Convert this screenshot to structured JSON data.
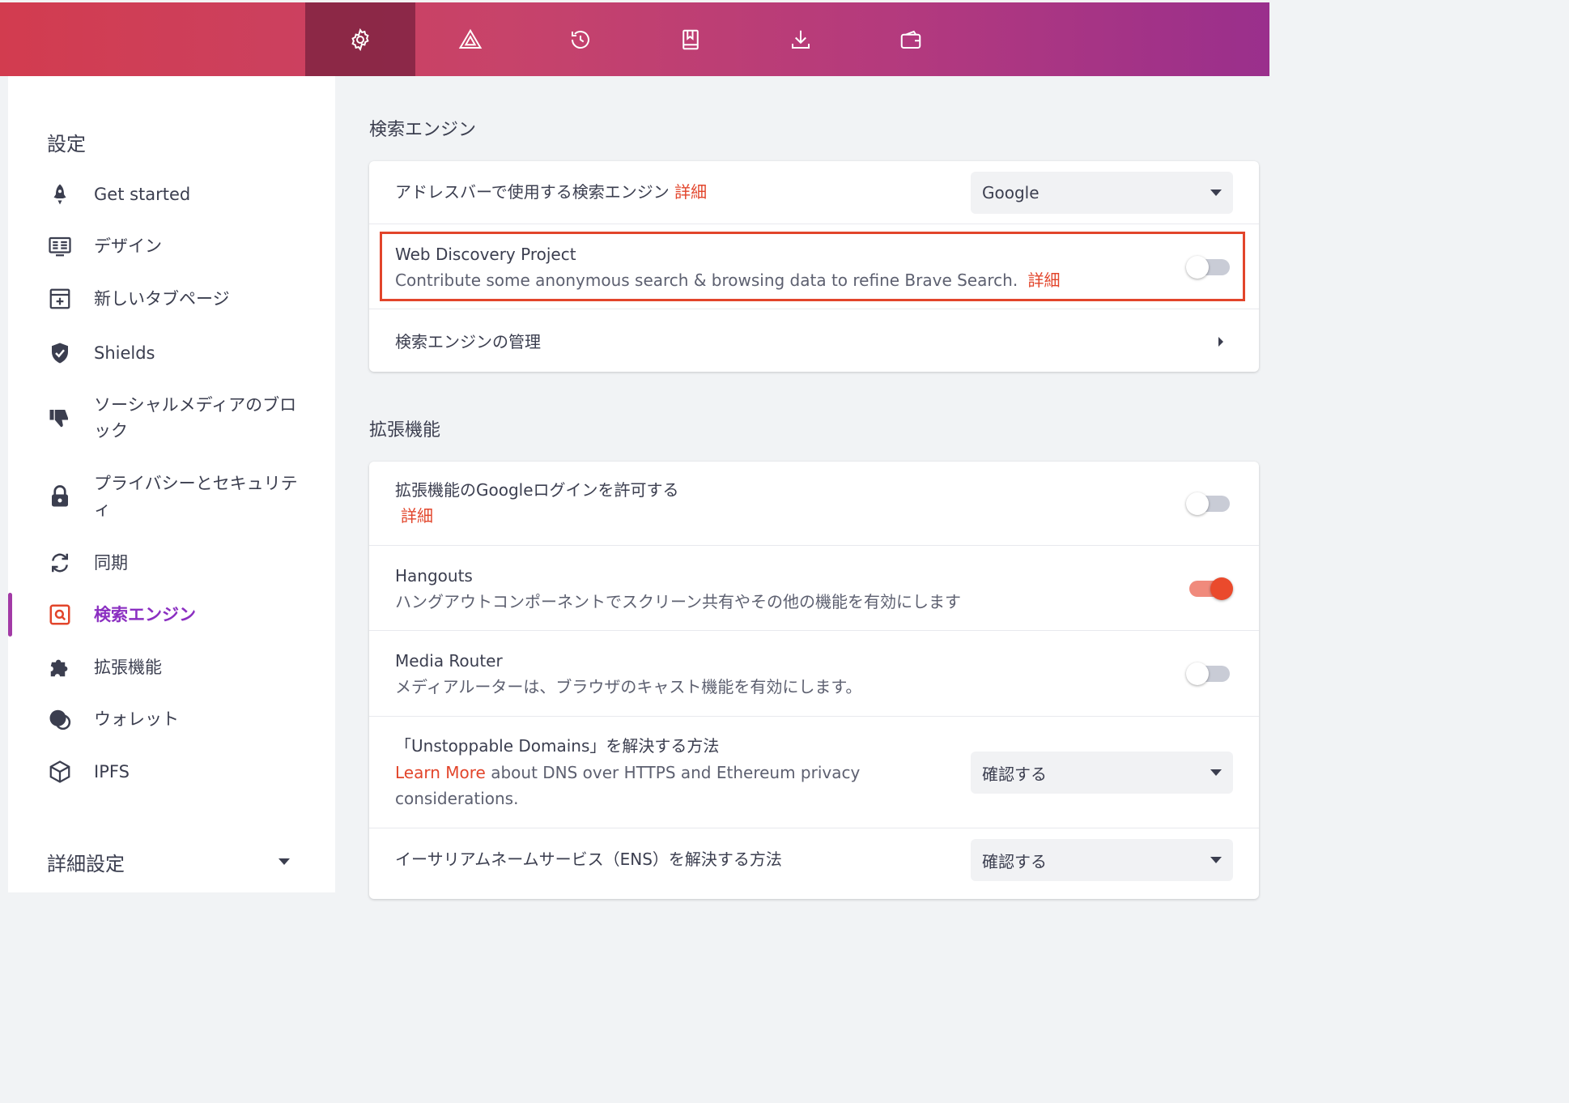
{
  "toolbar": {
    "items": [
      {
        "name": "settings",
        "icon": "gear-icon",
        "active": true
      },
      {
        "name": "brave-rewards",
        "icon": "triangle-icon"
      },
      {
        "name": "history",
        "icon": "history-icon"
      },
      {
        "name": "bookmarks",
        "icon": "bookmark-icon"
      },
      {
        "name": "downloads",
        "icon": "download-icon"
      },
      {
        "name": "wallet",
        "icon": "wallet-icon"
      }
    ]
  },
  "sidebar": {
    "title": "設定",
    "items": [
      {
        "label": "Get started",
        "icon": "rocket-icon"
      },
      {
        "label": "デザイン",
        "icon": "appearance-icon"
      },
      {
        "label": "新しいタブページ",
        "icon": "new-tab-icon"
      },
      {
        "label": "Shields",
        "icon": "shield-icon"
      },
      {
        "label": "ソーシャルメディアのブロック",
        "icon": "thumbs-down-icon"
      },
      {
        "label": "プライバシーとセキュリティ",
        "icon": "lock-icon"
      },
      {
        "label": "同期",
        "icon": "sync-icon"
      },
      {
        "label": "検索エンジン",
        "icon": "search-engine-icon",
        "active": true
      },
      {
        "label": "拡張機能",
        "icon": "puzzle-icon"
      },
      {
        "label": "ウォレット",
        "icon": "wallet-icon"
      },
      {
        "label": "IPFS",
        "icon": "cube-icon"
      }
    ],
    "advanced_label": "詳細設定"
  },
  "search_engine": {
    "section_title": "検索エンジン",
    "address_bar": {
      "label": "アドレスバーで使用する検索エンジン",
      "link": "詳細",
      "selected": "Google"
    },
    "web_discovery": {
      "title": "Web Discovery Project",
      "subtitle": "Contribute some anonymous search & browsing data to refine Brave Search.",
      "link": "詳細",
      "enabled": false
    },
    "manage": {
      "label": "検索エンジンの管理"
    }
  },
  "extensions": {
    "section_title": "拡張機能",
    "google_login": {
      "title": "拡張機能のGoogleログインを許可する",
      "link": "詳細",
      "enabled": false
    },
    "hangouts": {
      "title": "Hangouts",
      "subtitle": "ハングアウトコンポーネントでスクリーン共有やその他の機能を有効にします",
      "enabled": true
    },
    "media_router": {
      "title": "Media Router",
      "subtitle": "メディアルーターは、ブラウザのキャスト機能を有効にします。",
      "enabled": false
    },
    "unstoppable": {
      "title": "「Unstoppable Domains」を解決する方法",
      "link": "Learn More",
      "subtitle_line1": " about DNS over HTTPS and Ethereum privacy",
      "subtitle_line2": "considerations.",
      "selected": "確認する"
    },
    "ens": {
      "title": "イーサリアムネームサービス（ENS）を解決する方法",
      "selected": "確認する"
    }
  },
  "colors": {
    "accent": "#e2452b",
    "active_nav": "#8b2fc1"
  }
}
